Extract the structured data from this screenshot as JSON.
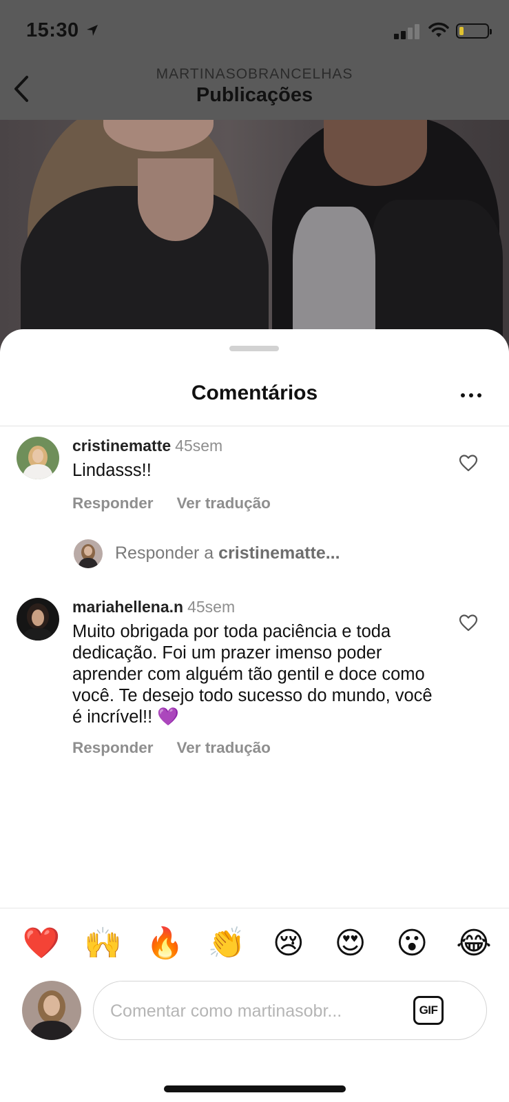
{
  "status_bar": {
    "time": "15:30"
  },
  "header": {
    "account": "MARTINASOBRANCELHAS",
    "title": "Publicações"
  },
  "sheet": {
    "title": "Comentários"
  },
  "comments": [
    {
      "username": "cristinematte",
      "time": "45sem",
      "text": "Lindasss!!",
      "reply_label": "Responder",
      "translate_label": "Ver tradução"
    },
    {
      "username": "mariahellena.n",
      "time": "45sem",
      "text": "Muito obrigada por toda paciência e toda dedicação. Foi um prazer imenso poder aprender com alguém tão gentil e doce como você. Te desejo todo sucesso do mundo, você é incrível!! 💜",
      "reply_label": "Responder",
      "translate_label": "Ver tradução"
    }
  ],
  "reply_prompt": {
    "prefix": "Responder a",
    "username": "cristinematte..."
  },
  "emoji_bar": [
    "❤️",
    "🙌",
    "🔥",
    "👏",
    "😢",
    "😍",
    "😮",
    "😂"
  ],
  "composer": {
    "placeholder": "Comentar como martinasobr...",
    "gif_label": "GIF"
  },
  "colors": {
    "muted_text": "#8e8e8e",
    "overlay": "#5a5a5a",
    "sheet": "#ffffff"
  },
  "icons": [
    "location-arrow-icon",
    "signal-icon",
    "wifi-icon",
    "battery-icon",
    "back-chevron-icon",
    "more-icon",
    "heart-outline-icon",
    "gif-icon"
  ]
}
